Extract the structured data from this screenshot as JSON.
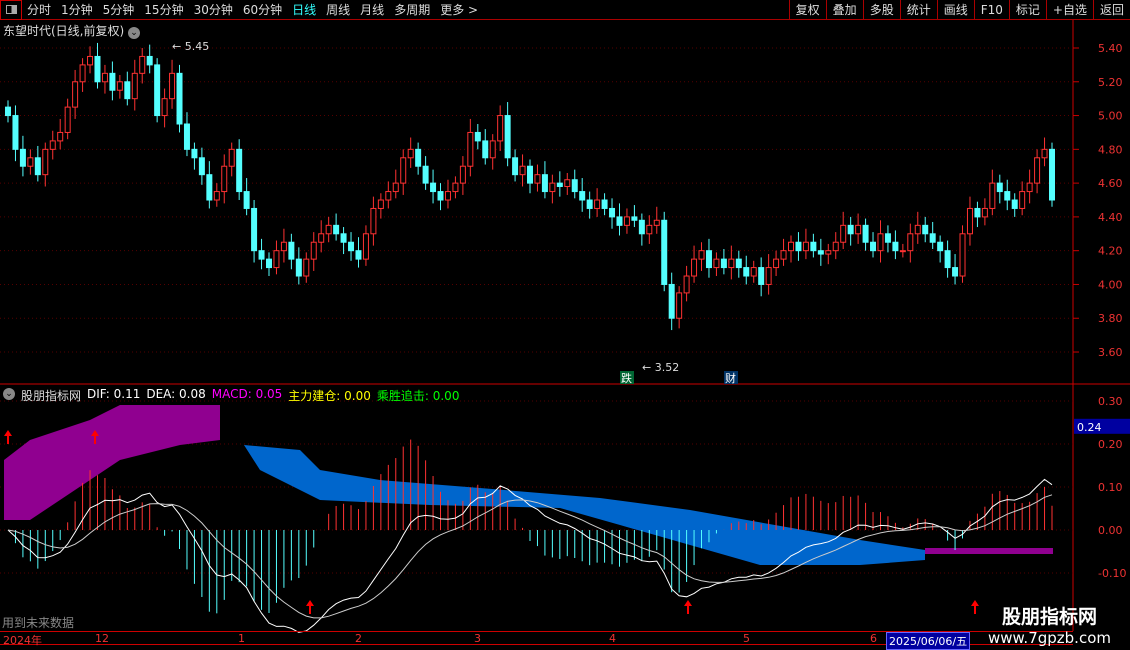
{
  "toolbar": {
    "tabs": [
      "分时",
      "1分钟",
      "5分钟",
      "15分钟",
      "30分钟",
      "60分钟",
      "日线",
      "周线",
      "月线",
      "多周期",
      "更多 >"
    ],
    "active": "日线",
    "right": [
      "复权",
      "叠加",
      "多股",
      "统计",
      "画线",
      "F10",
      "标记",
      "+自选",
      "返回"
    ]
  },
  "stock": {
    "title": "东望时代(日线,前复权)",
    "high_label": "5.45",
    "low_label": "3.52",
    "mark_die": "跌",
    "mark_cai": "财"
  },
  "price_axis": [
    "5.40",
    "5.20",
    "5.00",
    "4.80",
    "4.60",
    "4.40",
    "4.20",
    "4.00",
    "3.80",
    "3.60"
  ],
  "indicator": {
    "name": "股朋指标网",
    "dif": "DIF: 0.11",
    "dea": "DEA: 0.08",
    "macd": "MACD: 0.05",
    "zljc": "主力建仓: 0.00",
    "cszj": "乘胜追击: 0.00",
    "axis": [
      "0.30",
      "0.20",
      "0.10",
      "0.00",
      "-0.10"
    ],
    "current": "0.24",
    "note": "用到未来数据"
  },
  "dates": {
    "labels": [
      "2024年",
      "12",
      "1",
      "2",
      "3",
      "4",
      "5",
      "6"
    ],
    "current": "2025/06/06/五"
  },
  "watermark": {
    "name": "股朋指标网",
    "url": "www.7gpzb.com"
  },
  "colors": {
    "up": "#ff3232",
    "down": "#54ffff",
    "macd": "#ff00ff",
    "yellow": "#ffff00",
    "green": "#00ff00"
  },
  "chart_data": {
    "type": "candlestick",
    "closes": [
      5.0,
      4.8,
      4.7,
      4.75,
      4.65,
      4.8,
      4.85,
      4.9,
      5.05,
      5.2,
      5.3,
      5.35,
      5.2,
      5.25,
      5.15,
      5.2,
      5.1,
      5.25,
      5.35,
      5.3,
      5.0,
      5.1,
      5.25,
      4.95,
      4.8,
      4.75,
      4.65,
      4.5,
      4.55,
      4.7,
      4.8,
      4.55,
      4.45,
      4.2,
      4.15,
      4.1,
      4.2,
      4.25,
      4.15,
      4.05,
      4.15,
      4.25,
      4.3,
      4.35,
      4.3,
      4.25,
      4.2,
      4.15,
      4.3,
      4.45,
      4.5,
      4.55,
      4.6,
      4.75,
      4.8,
      4.7,
      4.6,
      4.55,
      4.5,
      4.55,
      4.6,
      4.7,
      4.9,
      4.85,
      4.75,
      4.85,
      5.0,
      4.75,
      4.65,
      4.7,
      4.6,
      4.65,
      4.55,
      4.6,
      4.58,
      4.62,
      4.55,
      4.5,
      4.45,
      4.5,
      4.45,
      4.4,
      4.35,
      4.4,
      4.38,
      4.3,
      4.35,
      4.38,
      4.0,
      3.8,
      3.95,
      4.05,
      4.15,
      4.2,
      4.1,
      4.15,
      4.1,
      4.15,
      4.1,
      4.05,
      4.1,
      4.0,
      4.1,
      4.15,
      4.2,
      4.25,
      4.2,
      4.25,
      4.2,
      4.18,
      4.2,
      4.25,
      4.35,
      4.3,
      4.35,
      4.25,
      4.2,
      4.3,
      4.25,
      4.2,
      4.2,
      4.3,
      4.35,
      4.3,
      4.25,
      4.2,
      4.1,
      4.05,
      4.3,
      4.45,
      4.4,
      4.45,
      4.6,
      4.55,
      4.5,
      4.45,
      4.55,
      4.6,
      4.75,
      4.8,
      4.5
    ],
    "ylim": [
      3.5,
      5.55
    ]
  }
}
